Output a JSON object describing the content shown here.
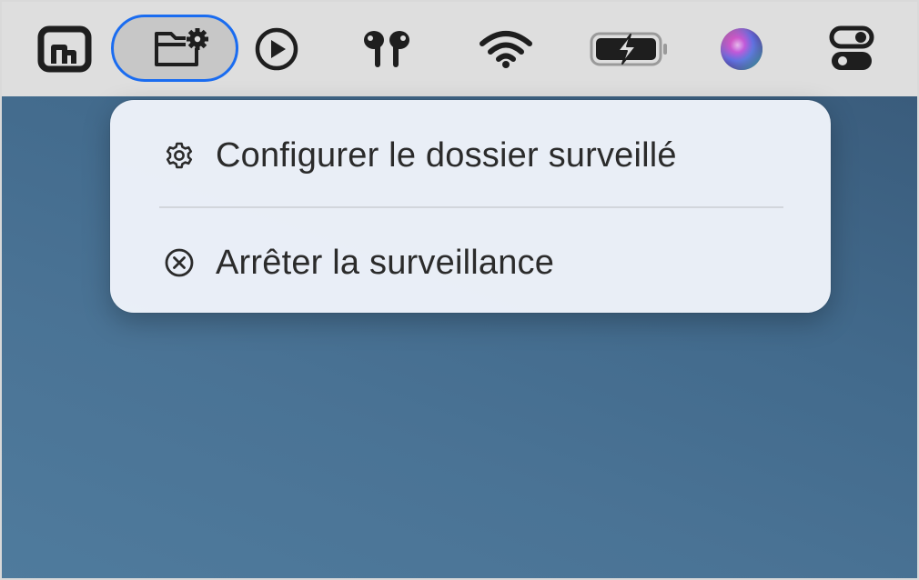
{
  "menubar": {
    "items": [
      {
        "name": "screen-mirroring-icon",
        "highlighted": false
      },
      {
        "name": "folder-gear-icon",
        "highlighted": true
      },
      {
        "name": "play-icon",
        "highlighted": false
      },
      {
        "name": "airpods-icon",
        "highlighted": false
      },
      {
        "name": "wifi-icon",
        "highlighted": false
      },
      {
        "name": "battery-charging-icon",
        "highlighted": false
      },
      {
        "name": "siri-icon",
        "highlighted": false
      },
      {
        "name": "control-center-icon",
        "highlighted": false
      }
    ]
  },
  "menu": {
    "items": [
      {
        "icon": "gear-icon",
        "label": "Configurer le dossier surveillé"
      },
      {
        "icon": "circle-x-icon",
        "label": "Arrêter la surveillance"
      }
    ]
  },
  "colors": {
    "menubar_bg": "#dedede",
    "highlight_border": "#1a6cf0",
    "desktop_bg": "#426a8c",
    "menu_bg": "#eef3fa",
    "text": "#2b2b2b"
  }
}
